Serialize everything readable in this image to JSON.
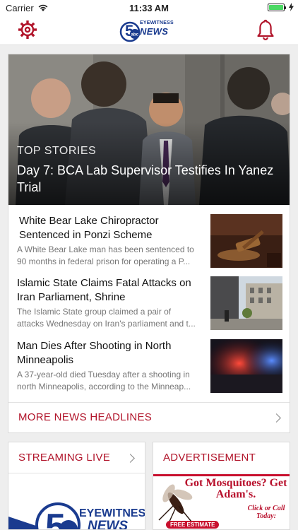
{
  "status_bar": {
    "carrier": "Carrier",
    "time": "11:33 AM"
  },
  "nav": {
    "logo_small": "EYEWITNESS",
    "logo_big": "NEWS",
    "logo_number": "5",
    "logo_network": "abc",
    "settings_icon": "gear-icon",
    "notifications_icon": "bell-icon"
  },
  "top_story": {
    "label": "TOP STORIES",
    "title": "Day 7: BCA Lab Supervisor Testifies In Yanez Trial"
  },
  "stories": [
    {
      "title": "White Bear Lake Chiropractor Sentenced in Ponzi Scheme",
      "summary_line1": "A White Bear Lake man has been sentenced to",
      "summary_line2": "90 months in federal prison for operating a P..."
    },
    {
      "title": "Islamic State Claims Fatal Attacks on Iran Parliament, Shrine",
      "summary_line1": "The Islamic State group claimed a pair of",
      "summary_line2": "attacks Wednesday on Iran's parliament and t..."
    },
    {
      "title": "Man Dies After Shooting in North Minneapolis",
      "summary_line1": "A 37-year-old died Tuesday after a shooting in",
      "summary_line2": "north Minneapolis, according to the Minneap..."
    }
  ],
  "more_headlines": "MORE NEWS HEADLINES",
  "streaming": {
    "label": "STREAMING LIVE",
    "logo_small": "EYEWITNESS",
    "logo_big": "NEWS"
  },
  "advertisement": {
    "label": "ADVERTISEMENT",
    "headline": "Got Mosquitoes? Get Adam's.",
    "side_text": "Click or Call Today:",
    "badge": "FREE ESTIMATE"
  },
  "colors": {
    "accent": "#b1142a",
    "brand_blue": "#1a3b8f"
  }
}
